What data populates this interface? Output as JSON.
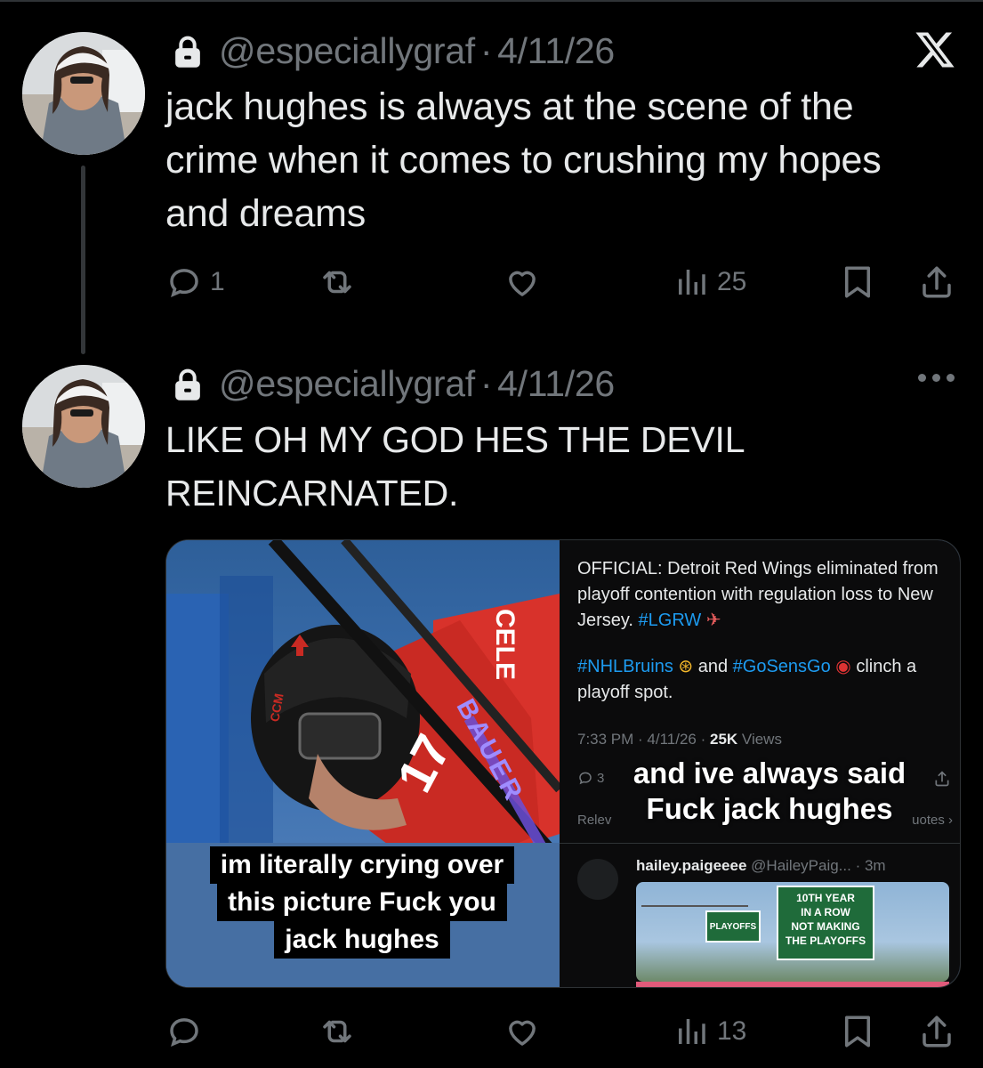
{
  "tweet1": {
    "handle": "@especiallygraf",
    "separator": "·",
    "date": "4/11/26",
    "text_line1": "jack hughes is always at the scene of the",
    "text_line2": "crime when it comes to crushing my hopes",
    "text_line3": "and dreams",
    "replies": "1",
    "views": "25"
  },
  "tweet2": {
    "handle": "@especiallygraf",
    "separator": "·",
    "date": "4/11/26",
    "text_line1": "LIKE OH MY GOD HES THE DEVIL",
    "text_line2": "REINCARNATED.",
    "views": "13"
  },
  "media": {
    "left_caption": [
      "im literally crying over",
      "this picture Fuck you",
      "jack hughes"
    ],
    "jersey_number": "17",
    "jersey_name": "CELE",
    "stick_brand": "BAUER",
    "helmet_brand": "CCM",
    "official_text": "OFFICIAL: Detroit Red Wings eliminated from playoff contention with regulation loss to New Jersey.",
    "official_tag": "#LGRW",
    "clinch_tag1": "#NHLBruins",
    "clinch_and": "and",
    "clinch_tag2": "#GoSensGo",
    "clinch_text1": "clinch a",
    "clinch_text2": "playoff spot.",
    "timestamp": "7:33 PM · 4/11/26 ·",
    "views_count": "25K",
    "views_label": "Views",
    "reply_count": "3",
    "overlay_line1": "and ive always said",
    "overlay_line2": "Fuck jack hughes",
    "relevant": "Relev",
    "quotes": "uotes ›",
    "reply_name": "hailey.paigeeee",
    "reply_handle": "@HaileyPaig...",
    "reply_time": "· 3m",
    "sign_left": "PLAYOFFS",
    "sign_right_line1": "10TH YEAR",
    "sign_right_line2": "IN A ROW",
    "sign_right_line3": "NOT MAKING",
    "sign_right_line4": "THE PLAYOFFS"
  },
  "icons": [
    "lock-icon",
    "x-logo-icon",
    "reply-icon",
    "repost-icon",
    "like-icon",
    "views-icon",
    "bookmark-icon",
    "share-icon",
    "more-icon"
  ],
  "colors": {
    "background": "#000000",
    "text": "#e7e9ea",
    "muted": "#71767b",
    "link": "#1d9bf0",
    "divider": "#2f3336"
  }
}
